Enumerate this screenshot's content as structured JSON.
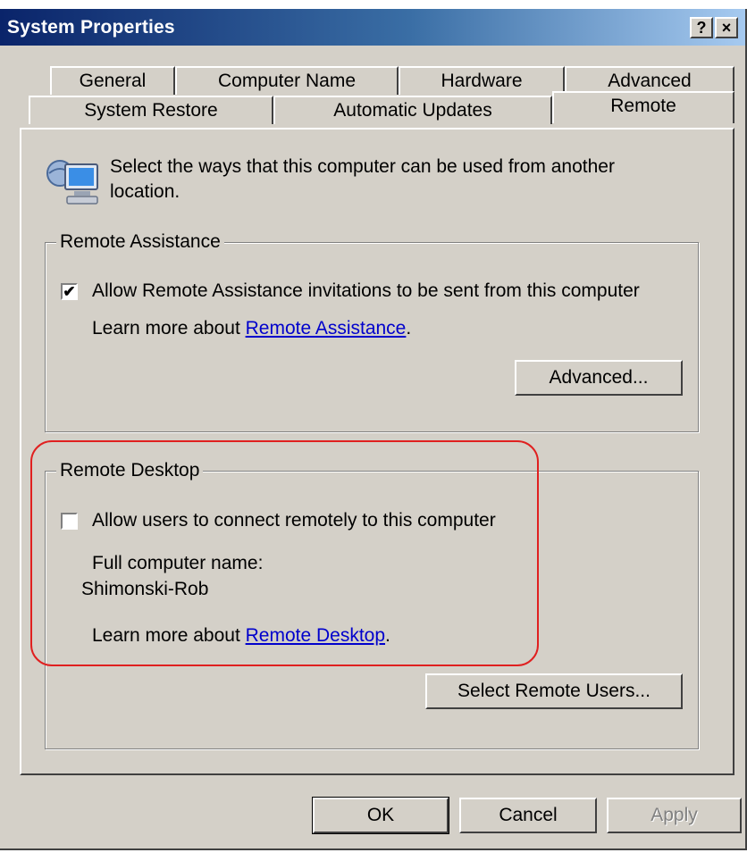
{
  "window": {
    "title": "System Properties",
    "help_button": "?",
    "close_button": "×"
  },
  "tabs": {
    "row_back": [
      {
        "label": "General"
      },
      {
        "label": "Computer Name"
      },
      {
        "label": "Hardware"
      },
      {
        "label": "Advanced"
      }
    ],
    "row_front": [
      {
        "label": "System Restore"
      },
      {
        "label": "Automatic Updates"
      },
      {
        "label": "Remote",
        "active": true
      }
    ]
  },
  "intro": {
    "icon": "computer-icon",
    "text": "Select the ways that this computer can be used from another location."
  },
  "remote_assistance": {
    "legend": "Remote Assistance",
    "checkbox_checked": true,
    "checkbox_label": "Allow Remote Assistance invitations to be sent from this computer",
    "learn_more_prefix": "Learn more about ",
    "learn_more_link": "Remote Assistance",
    "learn_more_suffix": ".",
    "advanced_button": "Advanced..."
  },
  "remote_desktop": {
    "legend": "Remote Desktop",
    "checkbox_checked": false,
    "checkbox_label": "Allow users to connect remotely to this computer",
    "computer_name_label": "Full computer name:",
    "computer_name_value": "Shimonski-Rob",
    "learn_more_prefix": "Learn more about ",
    "learn_more_link": "Remote Desktop",
    "learn_more_suffix": ".",
    "select_users_button": "Select Remote Users..."
  },
  "footer": {
    "ok": "OK",
    "cancel": "Cancel",
    "apply": "Apply"
  },
  "colors": {
    "dialog_face": "#d4d0c8",
    "titlebar_start": "#0a246a",
    "link": "#0000cc",
    "annotation": "#e02020"
  }
}
